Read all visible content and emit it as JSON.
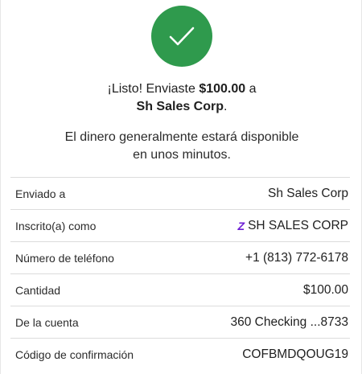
{
  "confirmation": {
    "headline_prefix": "¡Listo! Enviaste ",
    "amount": "$100.00",
    "headline_mid": " a",
    "recipient": "Sh Sales Corp",
    "headline_end": ".",
    "subline_1": "El dinero generalmente estará disponible",
    "subline_2": "en unos minutos."
  },
  "details": [
    {
      "label": "Enviado a",
      "value": "Sh Sales Corp"
    },
    {
      "label": "Inscrito(a) como",
      "value": "SH SALES CORP",
      "icon": "zelle-icon"
    },
    {
      "label": "Número de teléfono",
      "value": "+1 (813) 772-6178"
    },
    {
      "label": "Cantidad",
      "value": "$100.00"
    },
    {
      "label": "De la cuenta",
      "value": "360 Checking ...8733"
    },
    {
      "label": "Código de confirmación",
      "value": "COFBMDQOUG19"
    }
  ],
  "colors": {
    "success_green": "#2f9a4d",
    "zelle_purple": "#6d1ed4",
    "divider": "#dcdcdc"
  },
  "icons": {
    "success": "checkmark-icon",
    "zelle": "zelle-icon",
    "zelle_glyph": "Z"
  }
}
